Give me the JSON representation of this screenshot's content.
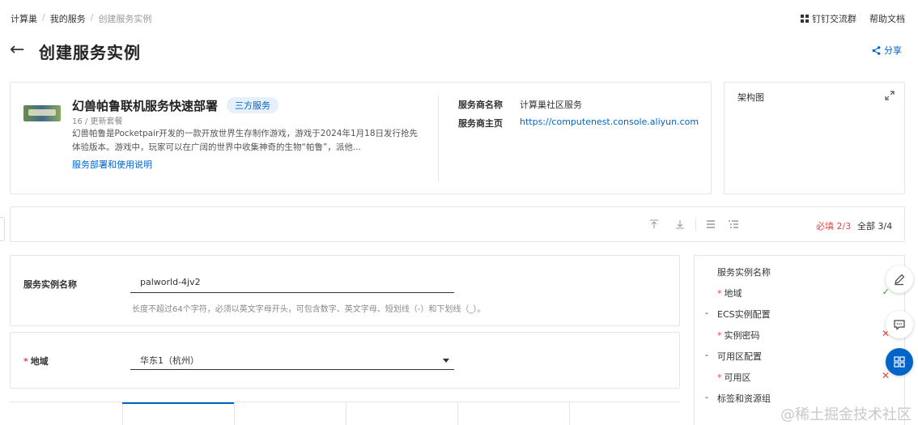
{
  "breadcrumb": [
    "计算巢",
    "我的服务",
    "创建服务实例"
  ],
  "breadcrumb_sep": "/",
  "top_links": {
    "dingtalk": "钉钉交流群",
    "help": "帮助文档"
  },
  "page": {
    "back_glyph": "←",
    "title": "创建服务实例",
    "share": "分享"
  },
  "service": {
    "name": "幻兽帕鲁联机服务快速部署",
    "tag": "三方服务",
    "meta": "16 / 更新套餐",
    "description": "幻兽帕鲁是Pocketpair开发的一款开放世界生存制作游戏，游戏于2024年1月18日发行抢先体验版本。游戏中，玩家可以在广阔的世界中收集神奇的生物“帕鲁”，派他...",
    "link": "服务部署和使用说明",
    "provider_label": "服务商名称",
    "provider_value": "计算巢社区服务",
    "homepage_label": "服务商主页",
    "homepage_value": "https://computenest.console.aliyun.com"
  },
  "architecture": {
    "title": "架构图"
  },
  "toolbar": {
    "required_label": "必填",
    "required_count": "2/3",
    "all_label": "全部",
    "all_count": "3/4"
  },
  "colors": {
    "accent": "#0064c8",
    "error": "#e64545",
    "ok": "#2ca02c"
  },
  "form": {
    "instance_name": {
      "label": "服务实例名称",
      "value": "palworld-4jv2",
      "hint": "长度不超过64个字符，必须以英文字母开头，可包含数字、英文字母、短划线（-）和下划线（_）。"
    },
    "region": {
      "required_mark": "*",
      "label": "地域",
      "value": "华东1（杭州）"
    }
  },
  "nav": {
    "items": [
      {
        "label": "服务实例名称"
      },
      {
        "label": "地域",
        "required": "*",
        "status": "ok"
      },
      {
        "label": "ECS实例配置",
        "group": "-"
      },
      {
        "label": "实例密码",
        "required": "*",
        "status": "error"
      },
      {
        "label": "可用区配置",
        "group": "-"
      },
      {
        "label": "可用区",
        "required": "*",
        "status": "error"
      },
      {
        "label": "标签和资源组",
        "group": "-"
      }
    ],
    "status_ok_glyph": "✓",
    "status_err_glyph": "✕"
  },
  "watermark": "@稀土掘金技术社区"
}
